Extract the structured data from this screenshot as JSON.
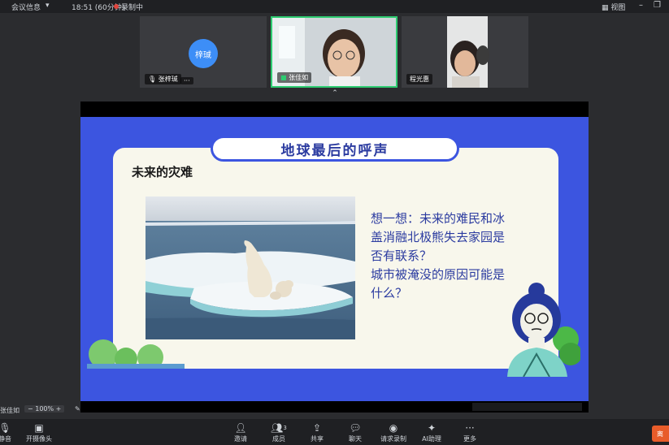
{
  "topbar": {
    "meeting_info": "会议信息",
    "time": "18:51 (60分钟)",
    "recording": "录制中",
    "view": "视图",
    "min_icon": "minimize-icon",
    "max_icon": "restore-icon",
    "close_icon": "close-icon"
  },
  "participants": [
    {
      "name": "张梓珹",
      "avatar_text": "梓珹",
      "avatar_color": "#3d8ef7"
    },
    {
      "name": "张佳如",
      "active": true
    },
    {
      "name": "程光惠"
    }
  ],
  "slide": {
    "title": "地球最后的呼声",
    "subtitle": "未来的灾难",
    "question_lines": [
      "想一想：未来的难民和冰",
      "盖消融北极熊失去家园是",
      "否有联系？",
      "城市被淹没的原因可能是",
      "什么？"
    ],
    "bg_color": "#3c55e0",
    "card_color": "#f8f7ec"
  },
  "zoom": {
    "name": "张佳如",
    "minus": "−",
    "value": "100%",
    "plus": "+"
  },
  "toolbar": {
    "mute": "静音",
    "video": "开摄像头",
    "invite": "邀请",
    "members": "成员",
    "members_count": "3",
    "share": "共享",
    "chat": "聊天",
    "request_record": "请求录制",
    "ai": "AI助理",
    "more": "更多",
    "leave": "离"
  }
}
